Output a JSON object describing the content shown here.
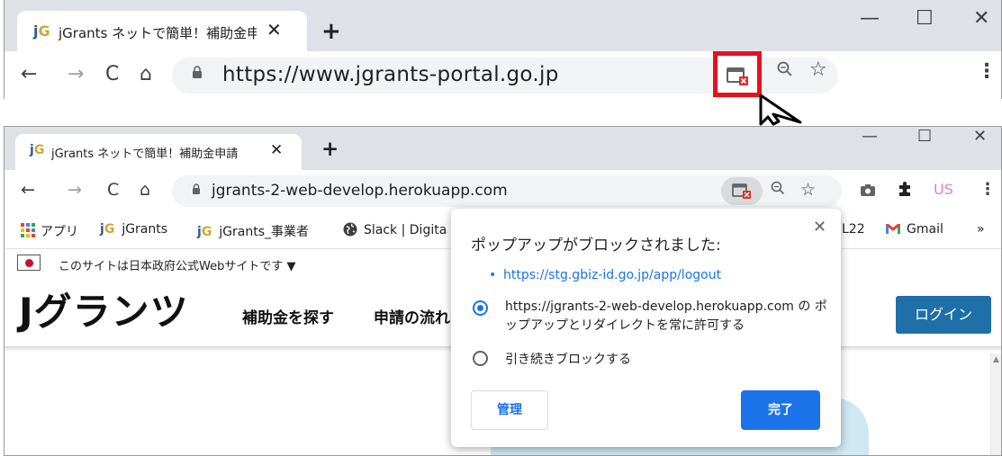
{
  "top_window": {
    "tab_logo": "jG",
    "tab_title": "jGrants ネットで簡単！補助金申請",
    "tab_close": "✕",
    "new_tab": "+",
    "minimize": "—",
    "maximize": "☐",
    "close": "✕",
    "back": "←",
    "forward": "→",
    "reload": "C",
    "home": "⌂",
    "lock": "🔒",
    "url": "https://www.jgrants-portal.go.jp",
    "popup_blocked_icon": "popup-blocked-icon",
    "highlight_color": "#e8101f",
    "zoom": "🔍",
    "star": "☆",
    "menu": "⋮"
  },
  "bottom_window": {
    "tab_logo": "jG",
    "tab_title": "jGrants ネットで簡単！補助金申請",
    "tab_close": "✕",
    "new_tab": "+",
    "minimize": "—",
    "maximize": "☐",
    "close": "✕",
    "back": "←",
    "forward": "→",
    "reload": "C",
    "home": "⌂",
    "lock": "🔒",
    "url": "jgrants-2-web-develop.herokuapp.com",
    "zoom": "🔍",
    "star": "☆",
    "camera": "📷",
    "extensions": "✱",
    "profile": "US",
    "menu": "⋮",
    "bookmarks": {
      "apps_label": "アプリ",
      "item1_logo": "jG",
      "item1_label": "jGrants",
      "item2_logo": "jG",
      "item2_label": "jGrants_事業者",
      "item3_label": "Slack | Digita",
      "item4_label": "L22",
      "item5_label": "Gmail",
      "overflow": "»"
    },
    "site": {
      "gov_notice": "このサイトは日本政府公式Webサイトです ▼",
      "logo": "Jグランツ",
      "nav1": "補助金を探す",
      "nav2": "申請の流れ",
      "login": "ログイン"
    }
  },
  "popup": {
    "title": "ポップアップがブロックされました:",
    "close": "✕",
    "blocked_link": "https://stg.gbiz-id.go.jp/app/logout",
    "option_allow": "https://jgrants-2-web-develop.herokuapp.com の ポップアップとリダイレクトを常に許可する",
    "option_block": "引き続きブロックする",
    "selected_option": "allow",
    "manage_button": "管理",
    "done_button": "完了",
    "accent_color": "#1a73e8"
  }
}
